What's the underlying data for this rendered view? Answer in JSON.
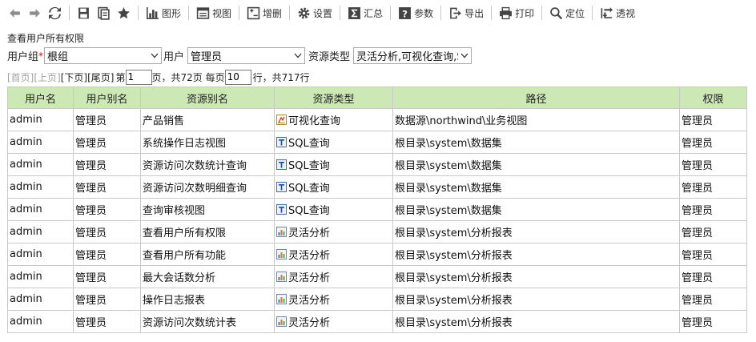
{
  "toolbar": {
    "chart_label": "图形",
    "view_label": "视图",
    "edit_label": "增删",
    "settings_label": "设置",
    "summary_label": "汇总",
    "params_label": "参数",
    "export_label": "导出",
    "print_label": "打印",
    "locate_label": "定位",
    "pivot_label": "透视"
  },
  "page_title": "查看用户所有权限",
  "filters": {
    "group_label": "用户组",
    "required_mark": "*",
    "group_value": "根组",
    "user_label": "用户",
    "user_value": "管理员",
    "type_label": "资源类型",
    "type_value": "灵活分析,可视化查询,S"
  },
  "pager": {
    "first": "[首页]",
    "prev": "[上页]",
    "next": "[下页]",
    "last": "[尾页]",
    "page_prefix": "第",
    "page_value": "1",
    "page_suffix": "页，共72页 每页",
    "per_page_value": "10",
    "per_page_suffix": "行，共717行"
  },
  "table": {
    "headers": [
      "用户名",
      "用户别名",
      "资源别名",
      "资源类型",
      "路径",
      "权限"
    ],
    "rows": [
      {
        "user": "admin",
        "alias": "管理员",
        "resource": "产品销售",
        "type_icon": "visual-query-icon",
        "type": "可视化查询",
        "path": "数据源\\northwind\\业务视图",
        "perm": "管理员"
      },
      {
        "user": "admin",
        "alias": "管理员",
        "resource": "系统操作日志视图",
        "type_icon": "sql-query-icon",
        "type": "SQL查询",
        "path": "根目录\\system\\数据集",
        "perm": "管理员"
      },
      {
        "user": "admin",
        "alias": "管理员",
        "resource": "资源访问次数统计查询",
        "type_icon": "sql-query-icon",
        "type": "SQL查询",
        "path": "根目录\\system\\数据集",
        "perm": "管理员"
      },
      {
        "user": "admin",
        "alias": "管理员",
        "resource": "资源访问次数明细查询",
        "type_icon": "sql-query-icon",
        "type": "SQL查询",
        "path": "根目录\\system\\数据集",
        "perm": "管理员"
      },
      {
        "user": "admin",
        "alias": "管理员",
        "resource": "查询审核视图",
        "type_icon": "sql-query-icon",
        "type": "SQL查询",
        "path": "根目录\\system\\数据集",
        "perm": "管理员"
      },
      {
        "user": "admin",
        "alias": "管理员",
        "resource": "查看用户所有权限",
        "type_icon": "flex-analysis-icon",
        "type": "灵活分析",
        "path": "根目录\\system\\分析报表",
        "perm": "管理员"
      },
      {
        "user": "admin",
        "alias": "管理员",
        "resource": "查看用户所有功能",
        "type_icon": "flex-analysis-icon",
        "type": "灵活分析",
        "path": "根目录\\system\\分析报表",
        "perm": "管理员"
      },
      {
        "user": "admin",
        "alias": "管理员",
        "resource": "最大会话数分析",
        "type_icon": "flex-analysis-icon",
        "type": "灵活分析",
        "path": "根目录\\system\\分析报表",
        "perm": "管理员"
      },
      {
        "user": "admin",
        "alias": "管理员",
        "resource": "操作日志报表",
        "type_icon": "flex-analysis-icon",
        "type": "灵活分析",
        "path": "根目录\\system\\分析报表",
        "perm": "管理员"
      },
      {
        "user": "admin",
        "alias": "管理员",
        "resource": "资源访问次数统计表",
        "type_icon": "flex-analysis-icon",
        "type": "灵活分析",
        "path": "根目录\\system\\分析报表",
        "perm": "管理员"
      }
    ]
  },
  "colors": {
    "header_bg": "#cce8b5",
    "border": "#c9c9c9",
    "disabled_text": "#a0a0a0",
    "required": "#e60000"
  }
}
